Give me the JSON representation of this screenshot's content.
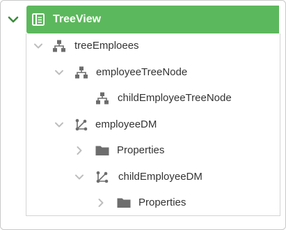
{
  "colors": {
    "accent": "#5cb85c",
    "icon": "#6d6d6d",
    "chevron": "#bdbdbd",
    "root_chevron": "#3d8b3d",
    "text": "#333333"
  },
  "tree": {
    "root": {
      "label": "TreeView",
      "icon": "treeview-icon",
      "expanded": true
    },
    "nodes": [
      {
        "label": "treeEmploees",
        "icon": "hierarchy-icon",
        "depth": 0,
        "expanded": true
      },
      {
        "label": "employeeTreeNode",
        "icon": "hierarchy-icon",
        "depth": 1,
        "expanded": true
      },
      {
        "label": "childEmployeeTreeNode",
        "icon": "hierarchy-icon",
        "depth": 2,
        "expanded": null
      },
      {
        "label": "employeeDM",
        "icon": "data-member-icon",
        "depth": 1,
        "expanded": true
      },
      {
        "label": "Properties",
        "icon": "folder-icon",
        "depth": 2,
        "expanded": false
      },
      {
        "label": "childEmployeeDM",
        "icon": "data-member-icon",
        "depth": 2,
        "expanded": true
      },
      {
        "label": "Properties",
        "icon": "folder-icon",
        "depth": 3,
        "expanded": false
      }
    ]
  }
}
